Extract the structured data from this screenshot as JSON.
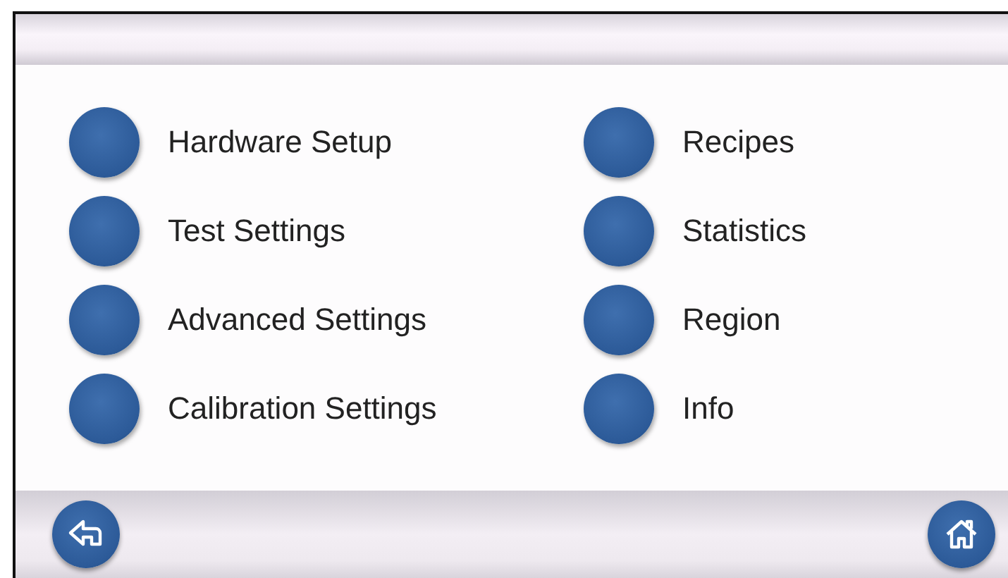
{
  "menu_columns": [
    {
      "items": [
        {
          "label": "Hardware Setup"
        },
        {
          "label": "Test Settings"
        },
        {
          "label": "Advanced Settings"
        },
        {
          "label": "Calibration Settings"
        }
      ]
    },
    {
      "items": [
        {
          "label": "Recipes"
        },
        {
          "label": "Statistics"
        },
        {
          "label": "Region"
        },
        {
          "label": "Info"
        }
      ]
    }
  ]
}
